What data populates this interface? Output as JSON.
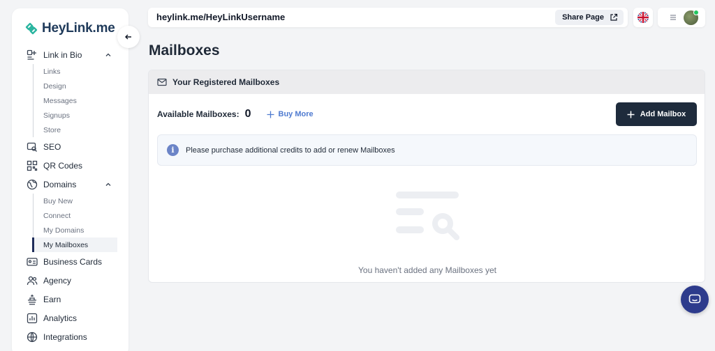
{
  "sidebar": {
    "logo": "HeyLink.me",
    "groups": [
      {
        "label": "Link in Bio",
        "icon": "link-in-bio-icon",
        "expanded": true,
        "children": [
          "Links",
          "Design",
          "Messages",
          "Signups",
          "Store"
        ]
      },
      {
        "label": "SEO",
        "icon": "seo-icon"
      },
      {
        "label": "QR Codes",
        "icon": "qr-code-icon"
      },
      {
        "label": "Domains",
        "icon": "globe-icon",
        "expanded": true,
        "children": [
          "Buy New",
          "Connect",
          "My Domains",
          "My Mailboxes"
        ]
      },
      {
        "label": "Business Cards",
        "icon": "business-card-icon"
      },
      {
        "label": "Agency",
        "icon": "agency-icon"
      },
      {
        "label": "Earn",
        "icon": "earn-icon"
      },
      {
        "label": "Analytics",
        "icon": "analytics-icon"
      },
      {
        "label": "Integrations",
        "icon": "integrations-icon"
      }
    ],
    "active_child": "My Mailboxes"
  },
  "topbar": {
    "url": "heylink.me/HeyLinkUsername",
    "share_label": "Share Page"
  },
  "page": {
    "title": "Mailboxes",
    "card_title": "Your Registered Mailboxes",
    "available_label": "Available Mailboxes:",
    "available_count": "0",
    "buy_more_label": "Buy More",
    "add_label": "Add Mailbox",
    "info_text": "Please purchase additional credits to add or renew Mailboxes",
    "empty_text": "You haven't added any Mailboxes yet"
  },
  "colors": {
    "primary_dark": "#1e2b3c",
    "link_blue": "#4f7bd0",
    "info_icon": "#6b84c7",
    "chat": "#2d3b8c"
  }
}
